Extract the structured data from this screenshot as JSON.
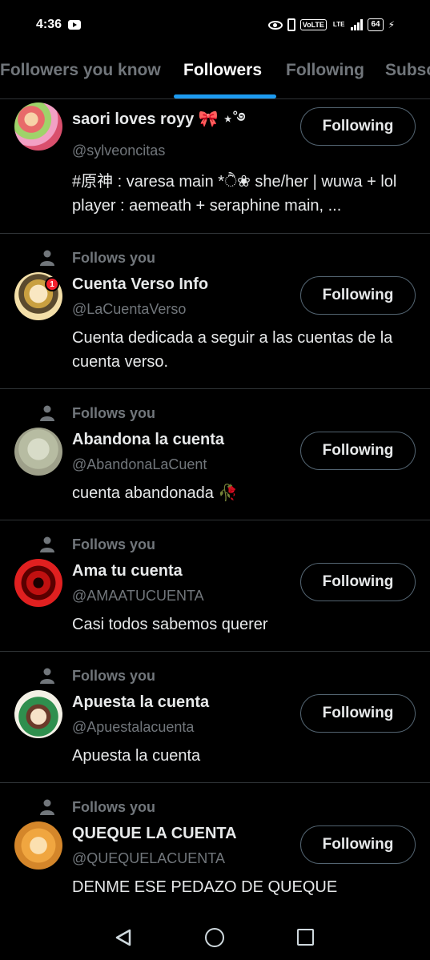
{
  "status": {
    "time": "4:36",
    "volte": "VoLTE",
    "lte": "LTE",
    "battery": "64"
  },
  "tabs": [
    {
      "label": "Followers you know"
    },
    {
      "label": "Followers"
    },
    {
      "label": "Following"
    },
    {
      "label": "Subsc"
    }
  ],
  "follows_you_label": "Follows you",
  "rows": [
    {
      "name": "saori loves royy 🎀 ⋆˚࿔",
      "handle": "@sylveoncitas",
      "bio": "#原神 : varesa main *ੈ❀ she/her | wuwa + lol player : aemeath + seraphine main, ...",
      "button": "Following"
    },
    {
      "name": "Cuenta Verso Info",
      "handle": "@LaCuentaVerso",
      "bio": "Cuenta dedicada a seguir a las cuentas de la cuenta verso.",
      "button": "Following",
      "badge": "1"
    },
    {
      "name": "Abandona la cuenta",
      "handle": "@AbandonaLaCuent",
      "bio": "cuenta abandonada 🥀",
      "button": "Following"
    },
    {
      "name": "Ama tu cuenta",
      "handle": "@AMAATUCUENTA",
      "bio": "Casi todos sabemos querer",
      "button": "Following"
    },
    {
      "name": "Apuesta la cuenta",
      "handle": "@Apuestalacuenta",
      "bio": "Apuesta la cuenta",
      "button": "Following"
    },
    {
      "name": "QUEQUE LA CUENTA",
      "handle": "@QUEQUELACUENTA",
      "bio": "DENME ESE PEDAZO DE QUEQUE",
      "button": "Following"
    }
  ],
  "colors": {
    "accent": "#1d9bf0",
    "muted": "#71767b",
    "divider": "#2f3336",
    "badge": "#f4212e"
  },
  "icons": [
    "youtube-icon",
    "eye-icon",
    "vibrate-icon",
    "signal-icon",
    "battery-icon",
    "person-icon",
    "back-icon",
    "home-icon",
    "recents-icon"
  ]
}
